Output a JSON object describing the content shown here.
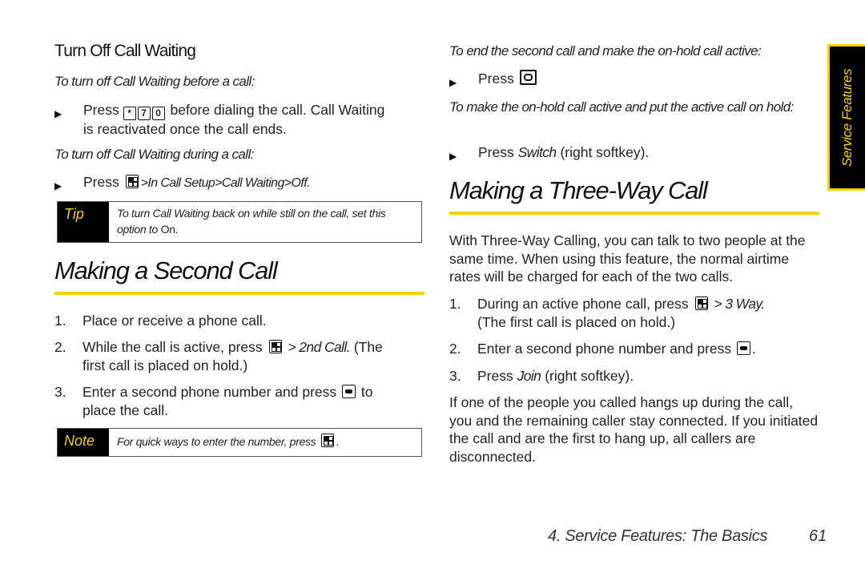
{
  "left": {
    "section_title": "Turn Off Call Waiting",
    "before_call_heading": "To turn off Call Waiting before a call:",
    "before_call_bullet": {
      "prefix": "Press",
      "keys": [
        "*",
        "7",
        "0"
      ],
      "line1": "before dialing the call. Call Waiting",
      "line2": "is reactivated once the call ends."
    },
    "during_call_heading": "To turn off Call Waiting during a call:",
    "during_call_bullet": {
      "prefix": "Press",
      "path": ">In Call Setup>Call Waiting>Off."
    },
    "tip": {
      "label": "Tip",
      "text": "To turn Call Waiting back on while still on the call, set this option to",
      "value": "On."
    },
    "second_call_title": "Making a Second Call",
    "steps": [
      {
        "num": "1.",
        "text": "Place or receive a phone call."
      },
      {
        "num": "2.",
        "pre": "While the call is active, press",
        "em": "> 2nd Call.",
        "post": "(The",
        "line2": "first call is placed on hold.)"
      },
      {
        "num": "3.",
        "pre": "Enter a second phone number and press",
        "post": "to",
        "line2": "place the call."
      }
    ],
    "note": {
      "label": "Note",
      "text": "For quick ways to enter the number, press"
    }
  },
  "right": {
    "end_second_heading": "To end the second call and make the on-hold call active:",
    "end_second_bullet": "Press",
    "switch_heading": "To make the on-hold call active and put the active call on hold:",
    "switch_bullet": {
      "pre": "Press",
      "em": "Switch",
      "post": "(right softkey)."
    },
    "three_way_title": "Making a Three-Way Call",
    "intro": "With Three-Way Calling, you can talk to two people at the same time. When using this feature, the normal airtime rates will be charged for each of the two calls.",
    "steps": [
      {
        "num": "1.",
        "pre": "During an active phone call, press",
        "em": "> 3 Way.",
        "line2": "(The first call is placed on hold.)"
      },
      {
        "num": "2.",
        "pre": "Enter a second phone number and press",
        "post": "."
      },
      {
        "num": "3.",
        "pre": "Press",
        "em": "Join",
        "post": "(right softkey)."
      }
    ],
    "outro": "If one of the people you called hangs up during the call, you and the remaining caller stay connected. If you initiated the call and are the first to hang up, all callers are disconnected."
  },
  "side_tab": "Service Features",
  "footer": {
    "section": "4. Service Features: The Basics",
    "page": "61"
  },
  "colors": {
    "accent": "#f7d200",
    "callout_label_bg": "#000000"
  }
}
